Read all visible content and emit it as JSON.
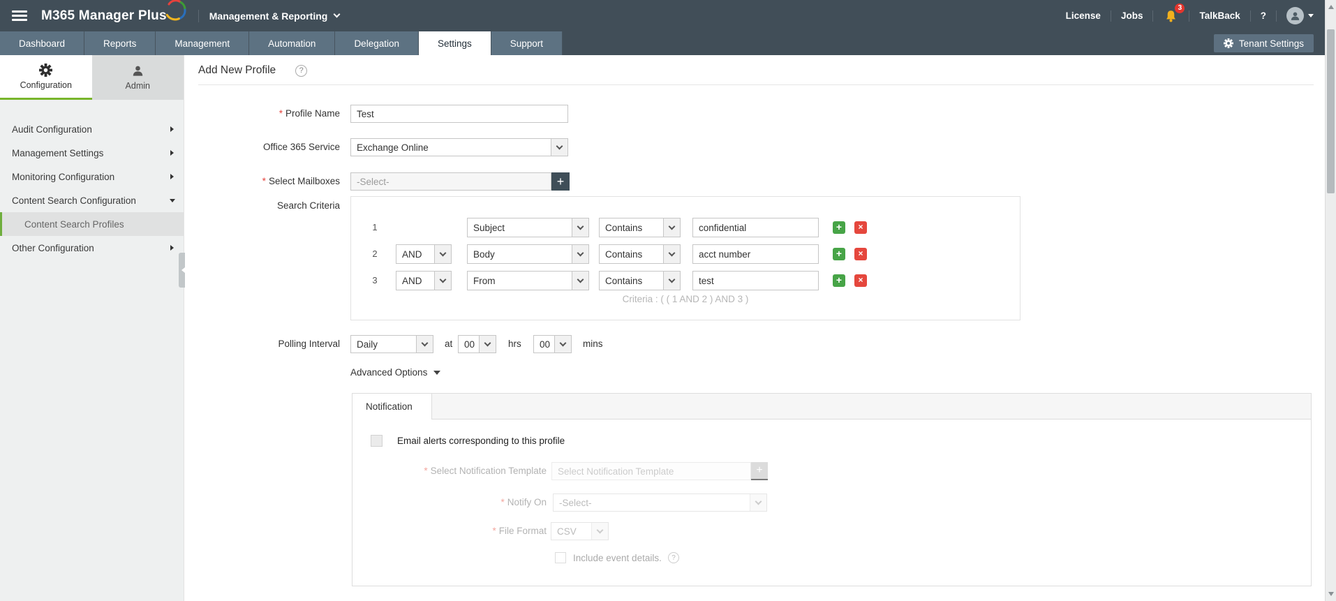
{
  "topbar": {
    "brand": "M365 Manager Plus",
    "context": "Management & Reporting",
    "license": "License",
    "jobs": "Jobs",
    "badge": "3",
    "talkback": "TalkBack",
    "help": "?"
  },
  "nav": {
    "tabs": [
      {
        "label": "Dashboard",
        "active": false
      },
      {
        "label": "Reports",
        "active": false
      },
      {
        "label": "Management",
        "active": false
      },
      {
        "label": "Automation",
        "active": false
      },
      {
        "label": "Delegation",
        "active": false
      },
      {
        "label": "Settings",
        "active": true
      },
      {
        "label": "Support",
        "active": false
      }
    ],
    "tenant_settings": "Tenant Settings"
  },
  "sidebar": {
    "tabs": [
      {
        "label": "Configuration",
        "active": true
      },
      {
        "label": "Admin",
        "active": false
      }
    ],
    "items": [
      {
        "label": "Audit Configuration"
      },
      {
        "label": "Management Settings"
      },
      {
        "label": "Monitoring Configuration"
      },
      {
        "label": "Content Search Configuration"
      },
      {
        "label": "Content Search Profiles",
        "selected": true
      },
      {
        "label": "Other Configuration"
      }
    ]
  },
  "page": {
    "title": "Add New Profile",
    "help": "?"
  },
  "form": {
    "required_marker": "*",
    "profile_name": {
      "label": "Profile Name",
      "value": "Test"
    },
    "service": {
      "label": "Office 365 Service",
      "value": "Exchange Online"
    },
    "mailboxes": {
      "label": "Select Mailboxes",
      "value": "-Select-",
      "add_label": "+"
    },
    "criteria": {
      "label": "Search Criteria",
      "rows": [
        {
          "num": "1",
          "field": "Subject",
          "op": "Contains",
          "value": "confidential"
        },
        {
          "num": "2",
          "bool": "AND",
          "field": "Body",
          "op": "Contains",
          "value": "acct number"
        },
        {
          "num": "3",
          "bool": "AND",
          "field": "From",
          "op": "Contains",
          "value": "test"
        }
      ],
      "summary": "Criteria : ( ( 1 AND 2 ) AND 3 )",
      "add_label": "+",
      "remove_label": "×"
    },
    "polling": {
      "label": "Polling Interval",
      "interval": "Daily",
      "at_label": "at",
      "hours": "00",
      "hrs_label": "hrs",
      "minutes": "00",
      "mins_label": "mins"
    },
    "advanced": {
      "label": "Advanced Options"
    }
  },
  "notification": {
    "tab": "Notification",
    "email_alerts": "Email alerts corresponding to this profile",
    "template": {
      "label": "Select Notification Template",
      "placeholder": "Select Notification Template",
      "add_label": "+"
    },
    "notify_on": {
      "label": "Notify On",
      "value": "-Select-"
    },
    "file_format": {
      "label": "File Format",
      "value": "CSV"
    },
    "include_event_details": "Include event details.",
    "help": "?"
  },
  "colors": {
    "topbar": "#414e58",
    "tab": "#5d7282",
    "accent_green": "#78b52b",
    "add_green": "#47a447",
    "remove_red": "#e5473d",
    "bell_yellow": "#f2b01e",
    "badge_red": "#e5352d"
  }
}
